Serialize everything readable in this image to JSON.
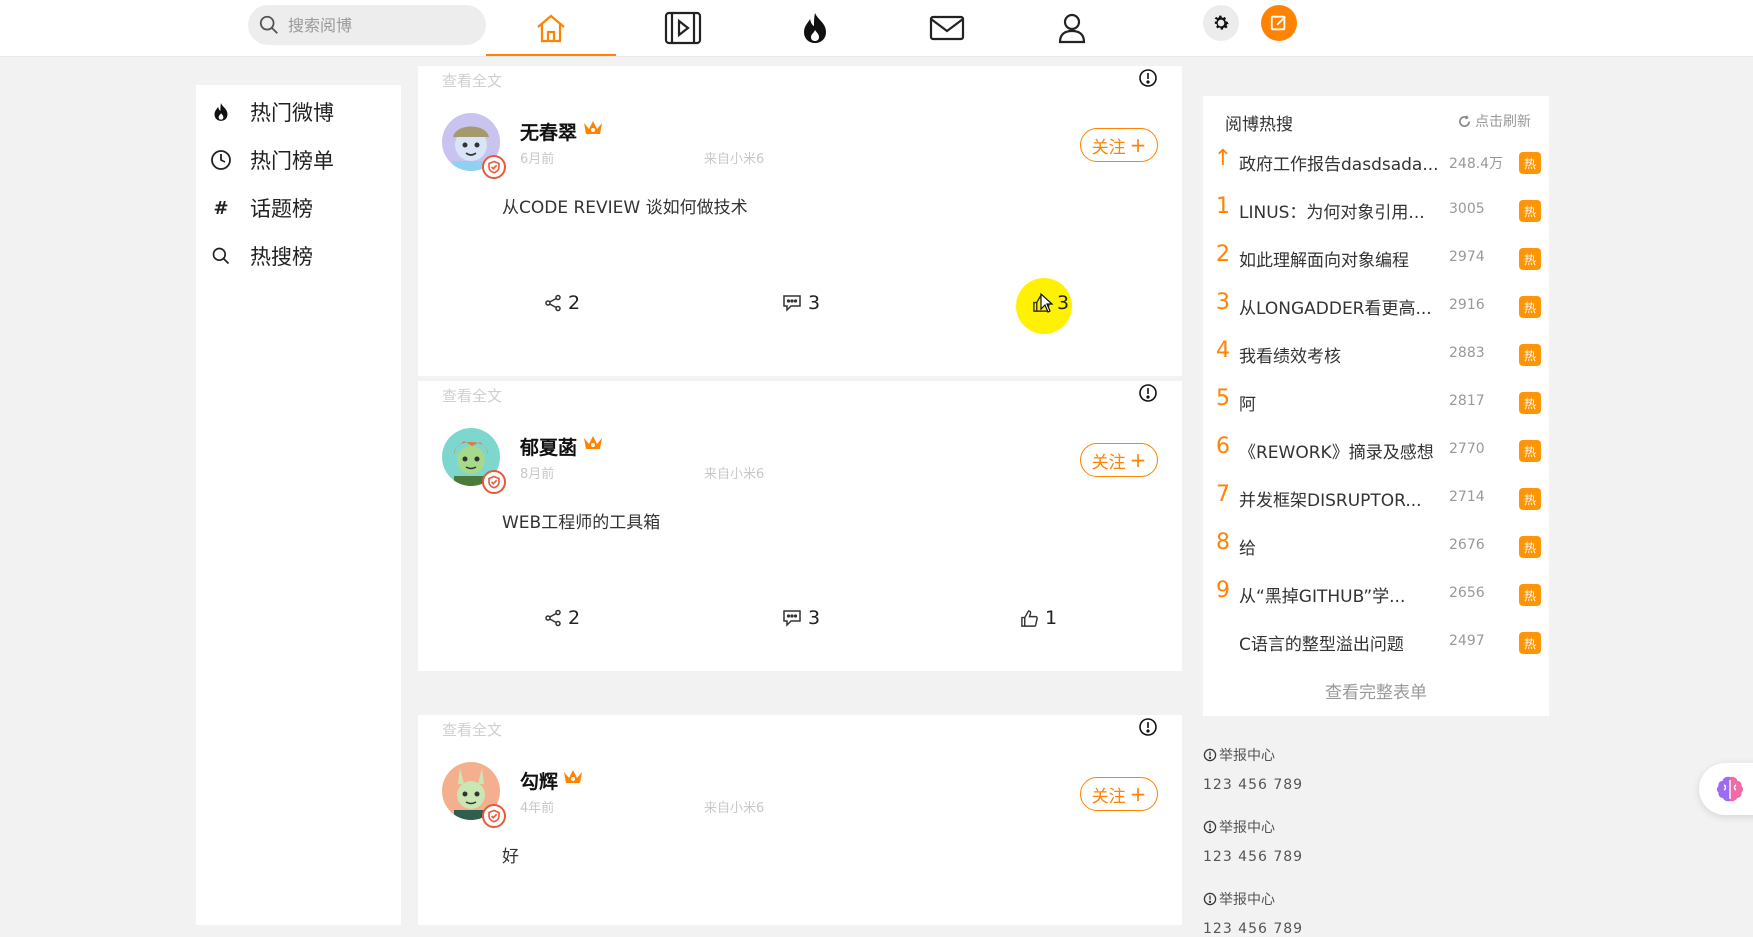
{
  "search": {
    "placeholder": "搜索阅博"
  },
  "sidebar": {
    "items": [
      {
        "label": "热门微博",
        "icon": "fire-icon"
      },
      {
        "label": "热门榜单",
        "icon": "clock-icon"
      },
      {
        "label": "话题榜",
        "icon": "hash-icon"
      },
      {
        "label": "热搜榜",
        "icon": "search-icon"
      }
    ]
  },
  "posts": [
    {
      "see_full": "查看全文",
      "name": "无春翠",
      "time": "6月前",
      "source": "来自小米6",
      "follow": "关注",
      "content": "从CODE REVIEW 谈如何做技术",
      "shares": "2",
      "comments": "3",
      "likes": "3"
    },
    {
      "see_full": "查看全文",
      "name": "郁夏菡",
      "time": "8月前",
      "source": "来自小米6",
      "follow": "关注",
      "content": "WEB工程师的工具箱",
      "shares": "2",
      "comments": "3",
      "likes": "1"
    },
    {
      "see_full": "查看全文",
      "name": "勾辉",
      "time": "4年前",
      "source": "来自小米6",
      "follow": "关注",
      "content": "好"
    }
  ],
  "hot": {
    "title": "阅博热搜",
    "refresh": "点击刷新",
    "badge": "热",
    "more": "查看完整表单",
    "items": [
      {
        "rank": "↑",
        "text": "政府工作报告dasdsada...",
        "count": "248.4万"
      },
      {
        "rank": "1",
        "text": "LINUS：为何对象引用...",
        "count": "3005"
      },
      {
        "rank": "2",
        "text": "如此理解面向对象编程",
        "count": "2974"
      },
      {
        "rank": "3",
        "text": "从LONGADDER看更高...",
        "count": "2916"
      },
      {
        "rank": "4",
        "text": "我看绩效考核",
        "count": "2883"
      },
      {
        "rank": "5",
        "text": "阿",
        "count": "2817"
      },
      {
        "rank": "6",
        "text": "《REWORK》摘录及感想",
        "count": "2770"
      },
      {
        "rank": "7",
        "text": "并发框架DISRUPTOR...",
        "count": "2714"
      },
      {
        "rank": "8",
        "text": "给",
        "count": "2676"
      },
      {
        "rank": "9",
        "text": "从“黑掉GITHUB”学...",
        "count": "2656"
      },
      {
        "rank": "",
        "text": "C语言的整型溢出问题",
        "count": "2497"
      }
    ]
  },
  "footer": [
    {
      "title": "举报中心",
      "number": "123 456 789"
    },
    {
      "title": "举报中心",
      "number": "123 456 789"
    },
    {
      "title": "举报中心",
      "number": "123 456 789"
    }
  ],
  "colors": {
    "accent": "#ff8200",
    "hot_badge": "#ff9406",
    "cursor_highlight": "#fff200"
  }
}
